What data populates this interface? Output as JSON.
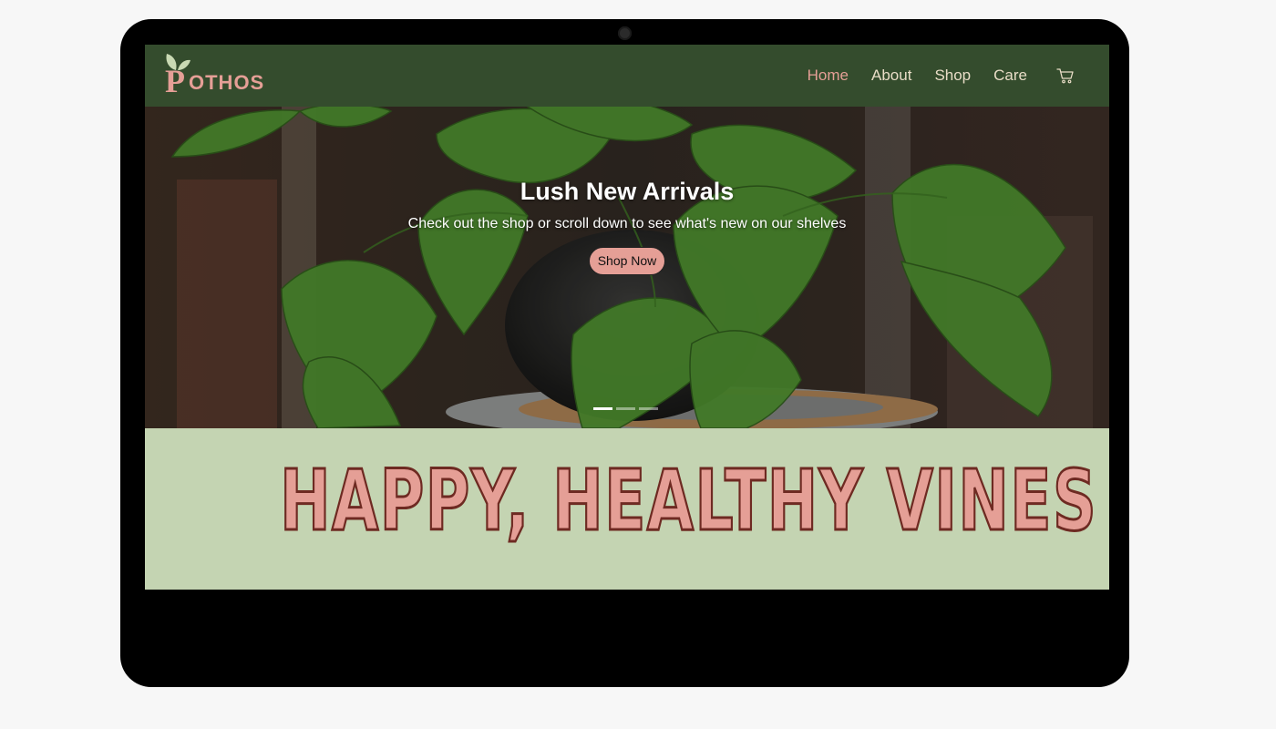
{
  "brand": {
    "logo_letter": "P",
    "logo_rest": "OTHOS"
  },
  "nav": {
    "items": [
      {
        "label": "Home",
        "active": true
      },
      {
        "label": "About",
        "active": false
      },
      {
        "label": "Shop",
        "active": false
      },
      {
        "label": "Care",
        "active": false
      }
    ],
    "cart_icon": "shopping-cart-icon"
  },
  "hero": {
    "title": "Lush New Arrivals",
    "subtitle": "Check out the shop or scroll down to see what's new on our shelves",
    "button_label": "Shop Now",
    "slides_total": 3,
    "active_slide": 1
  },
  "banner": {
    "text": "HAPPY, HEALTHY VINES"
  },
  "colors": {
    "nav_bg": "#344c2d",
    "accent_pink": "#e59f96",
    "banner_bg": "#c4d4b2",
    "banner_outline": "#6e2a22",
    "nav_text": "#e8dcc6"
  }
}
